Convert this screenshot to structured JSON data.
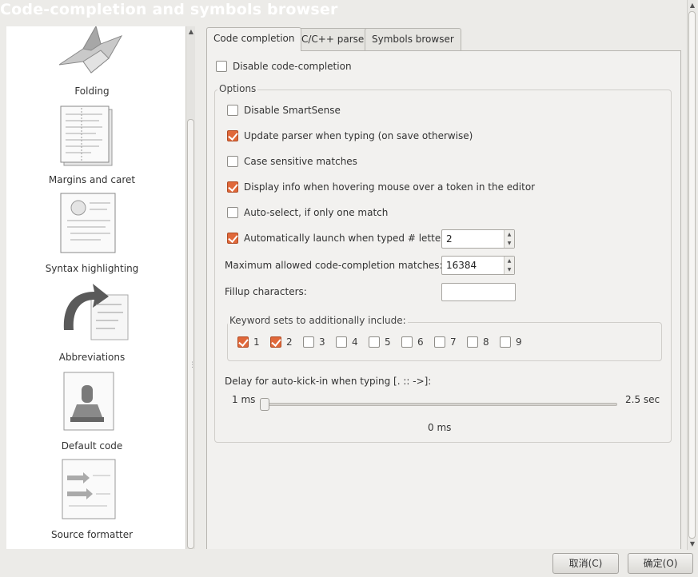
{
  "window": {
    "title": "Code-completion and symbols browser"
  },
  "sidebar": {
    "items": [
      {
        "label": "Folding",
        "icon": "origami-bird-icon"
      },
      {
        "label": "Margins and caret",
        "icon": "document-pages-icon"
      },
      {
        "label": "Syntax highlighting",
        "icon": "document-lightbulb-icon"
      },
      {
        "label": "Abbreviations",
        "icon": "arrow-code-icon"
      },
      {
        "label": "Default code",
        "icon": "stamp-document-icon"
      },
      {
        "label": "Source formatter",
        "icon": "arrows-document-icon"
      }
    ]
  },
  "tabs": [
    {
      "label": "Code completion",
      "active": true
    },
    {
      "label": "C/C++ parser",
      "active": false
    },
    {
      "label": "Symbols browser",
      "active": false
    }
  ],
  "code_completion": {
    "disable_label": "Disable code-completion",
    "disable_checked": false,
    "options_title": "Options",
    "options": [
      {
        "label": "Disable SmartSense",
        "checked": false
      },
      {
        "label": "Update parser when typing (on save otherwise)",
        "checked": true
      },
      {
        "label": "Case sensitive matches",
        "checked": false
      },
      {
        "label": "Display info when hovering mouse over a token in the editor",
        "checked": true
      },
      {
        "label": "Auto-select, if only one match",
        "checked": false
      },
      {
        "label": "Automatically launch when typed # letters:",
        "checked": true
      }
    ],
    "auto_launch_value": "2",
    "max_matches_label": "Maximum allowed code-completion matches:",
    "max_matches_value": "16384",
    "fillup_label": "Fillup characters:",
    "fillup_value": "",
    "keyword_sets_title": "Keyword sets to additionally include:",
    "keyword_sets": [
      {
        "label": "1",
        "checked": true
      },
      {
        "label": "2",
        "checked": true
      },
      {
        "label": "3",
        "checked": false
      },
      {
        "label": "4",
        "checked": false
      },
      {
        "label": "5",
        "checked": false
      },
      {
        "label": "6",
        "checked": false
      },
      {
        "label": "7",
        "checked": false
      },
      {
        "label": "8",
        "checked": false
      },
      {
        "label": "9",
        "checked": false
      }
    ],
    "delay_label": "Delay for auto-kick-in when typing [. :: ->]:",
    "delay_min_label": "1 ms",
    "delay_max_label": "2.5 sec",
    "delay_value_label": "0 ms",
    "delay_fraction": 0.0
  },
  "buttons": {
    "cancel": "取消(C)",
    "ok": "确定(O)"
  },
  "colors": {
    "checked_accent": "#e0683a",
    "background": "#ecebe8"
  }
}
